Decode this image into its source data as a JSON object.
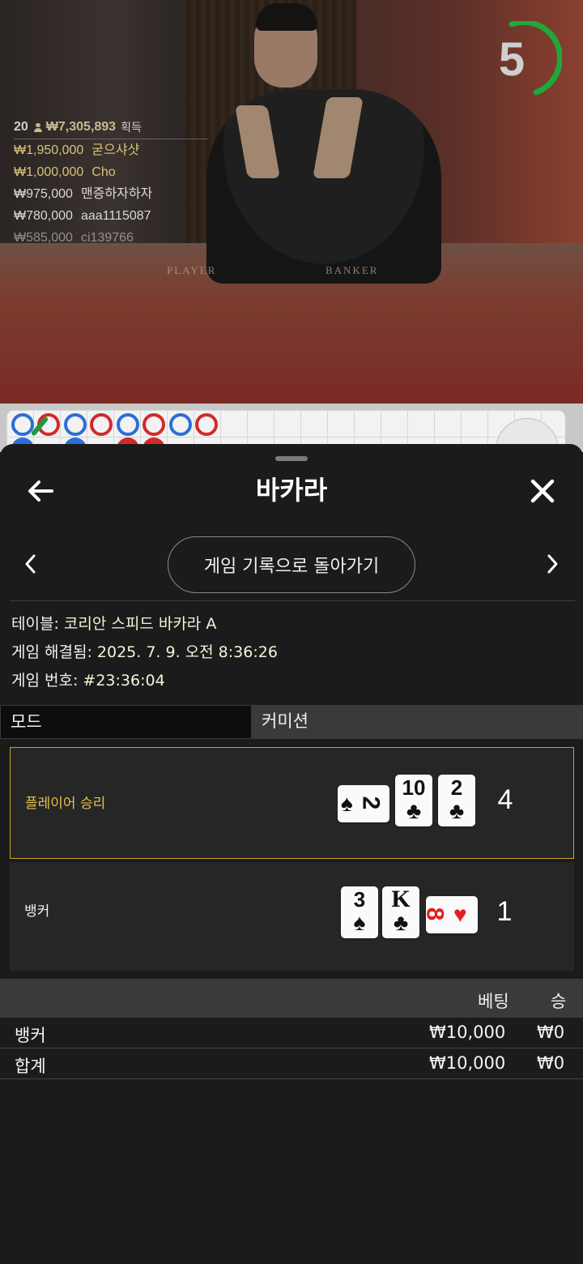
{
  "video": {
    "timer": "5",
    "table_labels": [
      "PLAYER",
      "BANKER"
    ],
    "winners": {
      "count": "20",
      "total": "₩7,305,893",
      "earned_label": "획득",
      "rows": [
        {
          "amount": "₩1,950,000",
          "name": "굳으샤샷"
        },
        {
          "amount": "₩1,000,000",
          "name": "Cho"
        },
        {
          "amount": "₩975,000",
          "name": "맨증하자하자"
        },
        {
          "amount": "₩780,000",
          "name": "aaa1115087"
        },
        {
          "amount": "₩585,000",
          "name": "ci139766"
        }
      ]
    }
  },
  "sheet": {
    "title": "바카라",
    "return_button": "게임 기록으로 돌아가기",
    "info": {
      "table_label": "테이블:",
      "table_value": "코리안 스피드 바카라 A",
      "resolved_label": "게임 해결됨:",
      "resolved_value": "2025. 7. 9. 오전 8:36:26",
      "game_no_label": "게임 번호:",
      "game_no_value": "#23:36:04"
    },
    "tabs": [
      "모드",
      "커미션"
    ],
    "player": {
      "label": "플레이어 승리",
      "score": "4",
      "cards": [
        {
          "rank": "2",
          "suit": "♠",
          "orientation": "horizontal"
        },
        {
          "rank": "10",
          "suit": "♣",
          "orientation": "vertical"
        },
        {
          "rank": "2",
          "suit": "♣",
          "orientation": "vertical"
        }
      ]
    },
    "banker": {
      "label": "뱅커",
      "score": "1",
      "cards": [
        {
          "rank": "3",
          "suit": "♠",
          "orientation": "vertical"
        },
        {
          "rank": "K",
          "suit": "♣",
          "orientation": "vertical"
        },
        {
          "rank": "8",
          "suit": "♥",
          "orientation": "horizontal"
        }
      ]
    },
    "bets": {
      "header": {
        "bet": "베팅",
        "win": "승"
      },
      "rows": [
        {
          "name": "뱅커",
          "bet": "₩10,000",
          "win": "₩0"
        },
        {
          "name": "합계",
          "bet": "₩10,000",
          "win": "₩0"
        }
      ]
    }
  },
  "colors": {
    "accent_gold": "#c9a227",
    "player_bead": "#2a6fd6",
    "banker_bead": "#d22a2a",
    "timer_ring": "#1fa83a"
  }
}
